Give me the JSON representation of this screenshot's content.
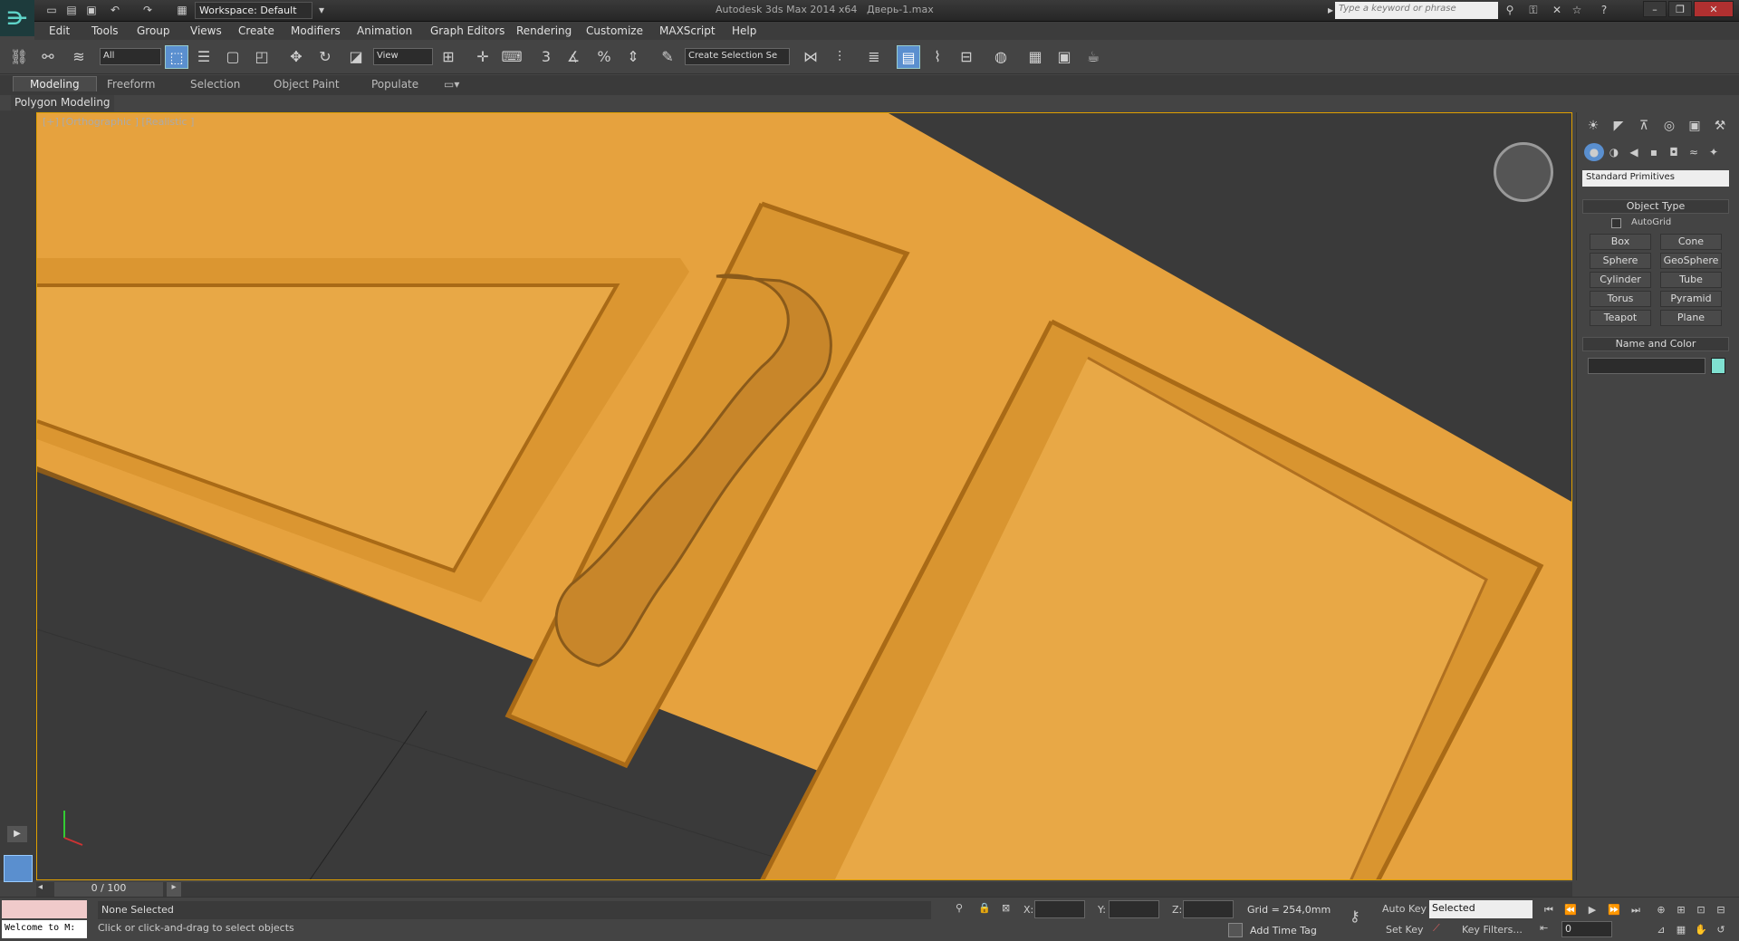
{
  "app": {
    "title": "Autodesk 3ds Max  2014 x64",
    "document": "Дверь-1.max",
    "workspace": "Workspace: Default",
    "search_placeholder": "Type a keyword or phrase"
  },
  "menu": [
    "Edit",
    "Tools",
    "Group",
    "Views",
    "Create",
    "Modifiers",
    "Animation",
    "Graph Editors",
    "Rendering",
    "Customize",
    "MAXScript",
    "Help"
  ],
  "toolbar": {
    "selection_filter": "All",
    "ref_coord": "View",
    "named_selection": "Create Selection Se",
    "snap_labels": [
      "3",
      "%"
    ]
  },
  "ribbon": {
    "tabs": [
      "Modeling",
      "Freeform",
      "Selection",
      "Object Paint",
      "Populate"
    ],
    "active_tab": "Modeling",
    "panel_label": "Polygon Modeling"
  },
  "viewport": {
    "label": "[+] [Orthographic ] [Realistic ]"
  },
  "command_panel": {
    "category": "Standard Primitives",
    "object_type_title": "Object Type",
    "autogrid": "AutoGrid",
    "buttons": [
      "Box",
      "Cone",
      "Sphere",
      "GeoSphere",
      "Cylinder",
      "Tube",
      "Torus",
      "Pyramid",
      "Teapot",
      "Plane"
    ],
    "name_color_title": "Name and Color",
    "swatch_color": "#7fe0d0"
  },
  "timeline": {
    "position": "0 / 100"
  },
  "status": {
    "maxscript": "Welcome to M:",
    "selection": "None Selected",
    "prompt": "Click or click-and-drag to select objects",
    "x_label": "X:",
    "y_label": "Y:",
    "z_label": "Z:",
    "grid": "Grid = 254,0mm",
    "add_time_tag": "Add Time Tag",
    "auto_key": "Auto Key",
    "set_key": "Set Key",
    "selected": "Selected",
    "key_filters": "Key Filters...",
    "frame": "0"
  },
  "colors": {
    "wood": "#e0a040",
    "wood_dark": "#b07020",
    "viewport_bg": "#3a3a3a",
    "accent": "#e0a000"
  }
}
